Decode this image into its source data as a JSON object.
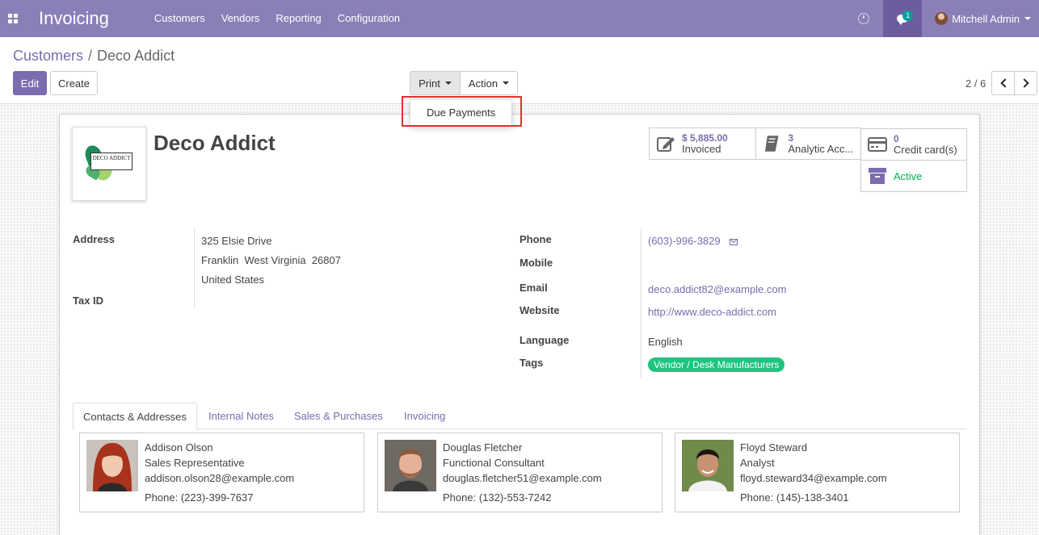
{
  "navbar": {
    "app_title": "Invoicing",
    "menu": [
      "Customers",
      "Vendors",
      "Reporting",
      "Configuration"
    ],
    "chat_count": "1",
    "user_name": "Mitchell Admin"
  },
  "breadcrumb": {
    "parent": "Customers",
    "separator": "/",
    "current": "Deco Addict"
  },
  "buttons": {
    "edit": "Edit",
    "create": "Create",
    "print": "Print",
    "action": "Action"
  },
  "pager": {
    "value": "2 / 6"
  },
  "print_menu": {
    "items": [
      "Due Payments"
    ]
  },
  "partner": {
    "name": "Deco Addict",
    "logo_text": "DECO ADDICT",
    "stats": {
      "invoiced_value": "$ 5,885.00",
      "invoiced_label": "Invoiced",
      "analytic_value": "3",
      "analytic_label": "Analytic Acc...",
      "credit_value": "0",
      "credit_label": "Credit card(s)",
      "active_label": "Active"
    },
    "fields": {
      "address_label": "Address",
      "address_street": "325 Elsie Drive",
      "address_city": "Franklin  West Virginia  26807",
      "address_country": "United States",
      "tax_label": "Tax ID",
      "phone_label": "Phone",
      "phone_value": "(603)-996-3829",
      "mobile_label": "Mobile",
      "email_label": "Email",
      "email_value": "deco.addict82@example.com",
      "website_label": "Website",
      "website_value": "http://www.deco-addict.com",
      "language_label": "Language",
      "language_value": "English",
      "tags_label": "Tags",
      "tag_value": "Vendor / Desk Manufacturers"
    }
  },
  "tabs": [
    "Contacts & Addresses",
    "Internal Notes",
    "Sales & Purchases",
    "Invoicing"
  ],
  "contacts": [
    {
      "name": "Addison Olson",
      "role": "Sales Representative",
      "email": "addison.olson28@example.com",
      "phone": "Phone: (223)-399-7637"
    },
    {
      "name": "Douglas Fletcher",
      "role": "Functional Consultant",
      "email": "douglas.fletcher51@example.com",
      "phone": "Phone: (132)-553-7242"
    },
    {
      "name": "Floyd Steward",
      "role": "Analyst",
      "email": "floyd.steward34@example.com",
      "phone": "Phone: (145)-138-3401"
    }
  ],
  "colors": {
    "brand": "#8b7fb8",
    "link": "#7c6bae",
    "tag": "#1fc47f",
    "active": "#00b050"
  }
}
